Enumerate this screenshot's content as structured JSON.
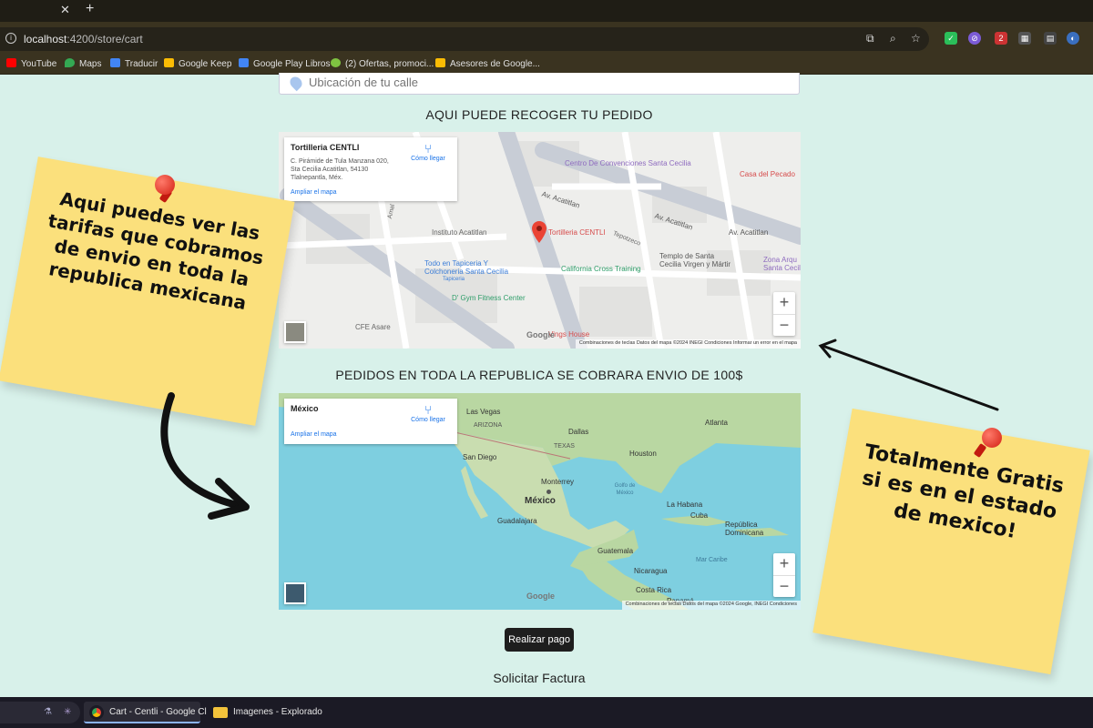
{
  "browser": {
    "url_host": "localhost",
    "url_rest": ":4200/store/cart",
    "bookmarks": [
      {
        "label": "YouTube",
        "color": "#ff0000"
      },
      {
        "label": "Maps",
        "color": "#34a853"
      },
      {
        "label": "Traducir",
        "color": "#4285f4"
      },
      {
        "label": "Google Keep",
        "color": "#fbbc04"
      },
      {
        "label": "Google Play Libros",
        "color": "#4285f4"
      },
      {
        "label": "(2) Ofertas, promoci...",
        "color": "#7fc241"
      },
      {
        "label": "Asesores de Google...",
        "color": "#fbbc04"
      }
    ],
    "extension_badge": "2"
  },
  "street": {
    "placeholder": "Ubicación de tu calle"
  },
  "pickup": {
    "title": "AQUI PUEDE RECOGER TU PEDIDO",
    "card_name": "Tortilleria CENTLI",
    "card_address": "C. Pirámide de Tula Manzana 020, Sta Cecilia Acatitlan, 54130 Tlalnepantla, Méx.",
    "card_link": "Ampliar el mapa",
    "directions": "Cómo llegar",
    "marker_label": "Tortilleria CENTLI",
    "places": [
      "Centro De Convenciones Santa Cecilia",
      "Casa del Pecado",
      "Av. Acatitlan",
      "Instituto Acatitlan",
      "Todo en Tapiceria Y Colchoneria Santa Cecilia",
      "Tapiceria",
      "D' Gym Fitness Center",
      "California Cross Training",
      "Templo de Santa Cecilia Virgen y Mártir",
      "Zona Arqu Santa Cecil",
      "CFE Asare",
      "Vings House",
      "Tepotzeco",
      "Amal"
    ],
    "google": "Google",
    "attribution": "Combinaciones de teclas   Datos del mapa ©2024 INEGI   Condiciones   Informar un error en el mapa"
  },
  "nationwide": {
    "title": "PEDIDOS EN TODA LA REPUBLICA SE COBRARA ENVIO DE 100$",
    "card_name": "México",
    "card_link": "Ampliar el mapa",
    "directions": "Cómo llegar",
    "places": [
      "México",
      "Monterrey",
      "Guadalajara",
      "La Habana",
      "Cuba",
      "Guatemala",
      "Nicaragua",
      "Costa Rica",
      "Panamá",
      "República Dominicana",
      "Golfo de México",
      "Mar Caribe",
      "Dallas",
      "TEXAS",
      "San Diego",
      "Houston",
      "ARIZONA",
      "Las Vegas",
      "Atlanta"
    ],
    "google": "Google",
    "attribution": "Combinaciones de teclas   Datos del mapa ©2024 Google, INEGI   Condiciones"
  },
  "actions": {
    "pay": "Realizar pago",
    "invoice": "Solicitar Factura"
  },
  "notes": {
    "left": "Aqui puedes ver las tarifas que cobramos de envio en toda la republica mexicana",
    "right": "Totalmente Gratis si es en el estado de mexico!"
  },
  "taskbar": [
    {
      "label": "Cart - Centli - Google Cl"
    },
    {
      "label": "Imagenes - Explorador d"
    }
  ],
  "colors": {
    "page_bg": "#d8f1ea",
    "note": "#fbe07c",
    "pin": "#d21f12",
    "link_blue": "#1a73e8",
    "marker_red": "#ea4335",
    "ocean": "#7ecfe0",
    "land": "#b9d7a2"
  }
}
